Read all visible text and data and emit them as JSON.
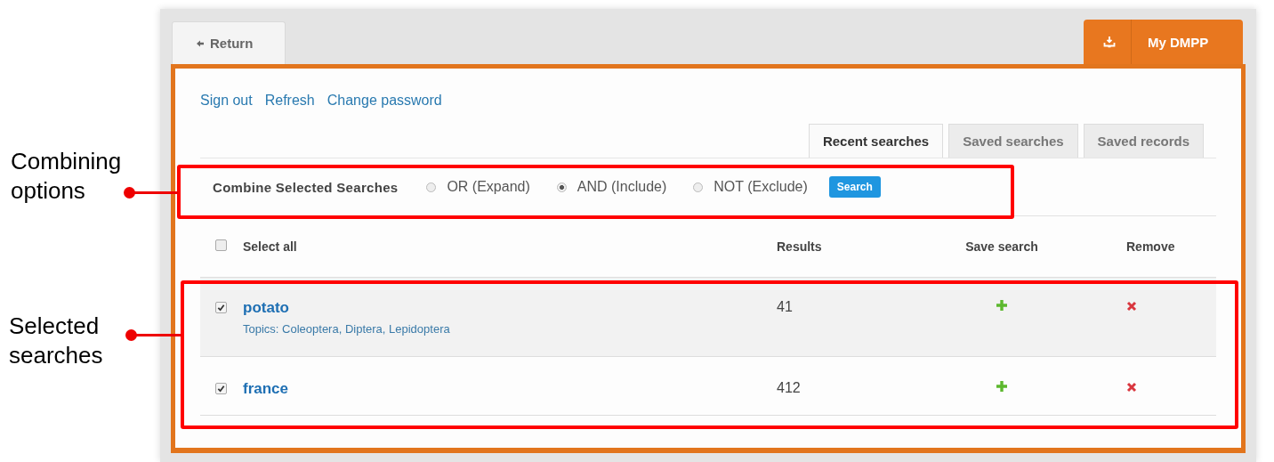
{
  "nav": {
    "return_label": "Return",
    "brand": "My DMPP"
  },
  "account_links": [
    "Sign out",
    "Refresh",
    "Change password"
  ],
  "tabs": [
    {
      "label": "Recent searches",
      "selected": true
    },
    {
      "label": "Saved searches",
      "selected": false
    },
    {
      "label": "Saved records",
      "selected": false
    }
  ],
  "combine": {
    "label": "Combine Selected Searches",
    "button": "Search",
    "options": [
      {
        "label": "OR (Expand)",
        "selected": false
      },
      {
        "label": "AND (Include)",
        "selected": true
      },
      {
        "label": "NOT (Exclude)",
        "selected": false
      }
    ]
  },
  "table": {
    "select_all": {
      "label": "Select all",
      "checked": false
    },
    "columns": [
      "Results",
      "Save search",
      "Remove"
    ],
    "rows": [
      {
        "query": "potato",
        "topics": "Topics: Coleoptera, Diptera, Lepidoptera",
        "checked": true,
        "results": "41"
      },
      {
        "query": "france",
        "checked": true,
        "results": "412"
      }
    ]
  },
  "annotations": [
    {
      "kind": "combine",
      "text": "Combining options"
    },
    {
      "kind": "rows",
      "text": "Selected searches"
    }
  ]
}
